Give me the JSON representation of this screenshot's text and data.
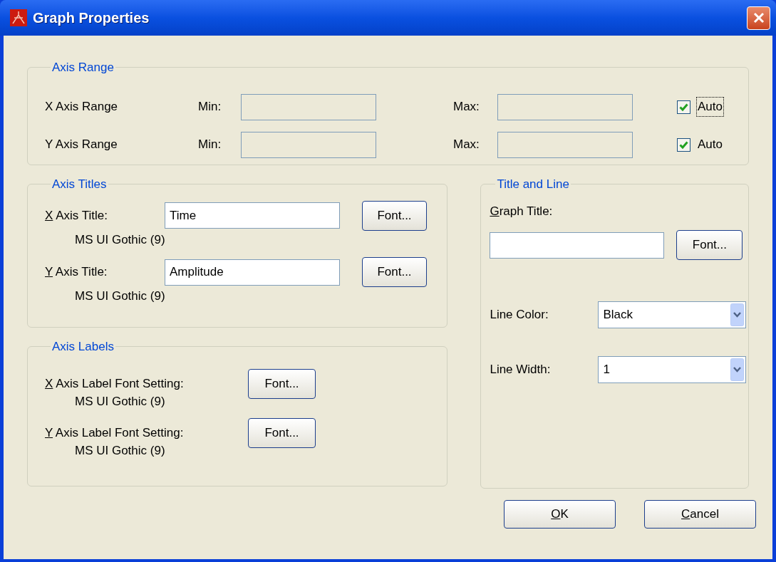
{
  "window": {
    "title": "Graph Properties"
  },
  "axis_range": {
    "title": "Axis Range",
    "rows": [
      {
        "label": "X Axis Range",
        "min_label": "Min:",
        "max_label": "Max:",
        "auto": {
          "label": "Auto",
          "checked": true,
          "focused": true
        }
      },
      {
        "label": "Y Axis Range",
        "min_label": "Min:",
        "max_label": "Max:",
        "auto": {
          "label": "Auto",
          "checked": true,
          "focused": false
        }
      }
    ]
  },
  "axis_titles": {
    "title": "Axis Titles",
    "rows": [
      {
        "label": "X Axis Title:",
        "mnemonic": true,
        "value": "Time",
        "font_button": "Font...",
        "font_name": "MS UI Gothic (9)"
      },
      {
        "label": "Y Axis Title:",
        "mnemonic": true,
        "value": "Amplitude",
        "font_button": "Font...",
        "font_name": "MS UI Gothic (9)"
      }
    ]
  },
  "axis_labels": {
    "title": "Axis Labels",
    "rows": [
      {
        "label": "X Axis Label Font Setting:",
        "mnemonic": true,
        "font_button": "Font...",
        "font_name": "MS UI Gothic (9)"
      },
      {
        "label": "Y Axis Label Font Setting:",
        "mnemonic": true,
        "font_button": "Font...",
        "font_name": "MS UI Gothic (9)"
      }
    ]
  },
  "title_and_line": {
    "title": "Title and Line",
    "graph_title": {
      "label": "Graph Title:",
      "mnemonic": true,
      "font_button": "Font..."
    },
    "line_color": {
      "label": "Line Color:",
      "value": "Black"
    },
    "line_width": {
      "label": "Line Width:",
      "value": "1"
    }
  },
  "buttons": [
    {
      "label": "OK",
      "mnemonic": true
    },
    {
      "label": "Cancel",
      "mnemonic": true
    }
  ]
}
